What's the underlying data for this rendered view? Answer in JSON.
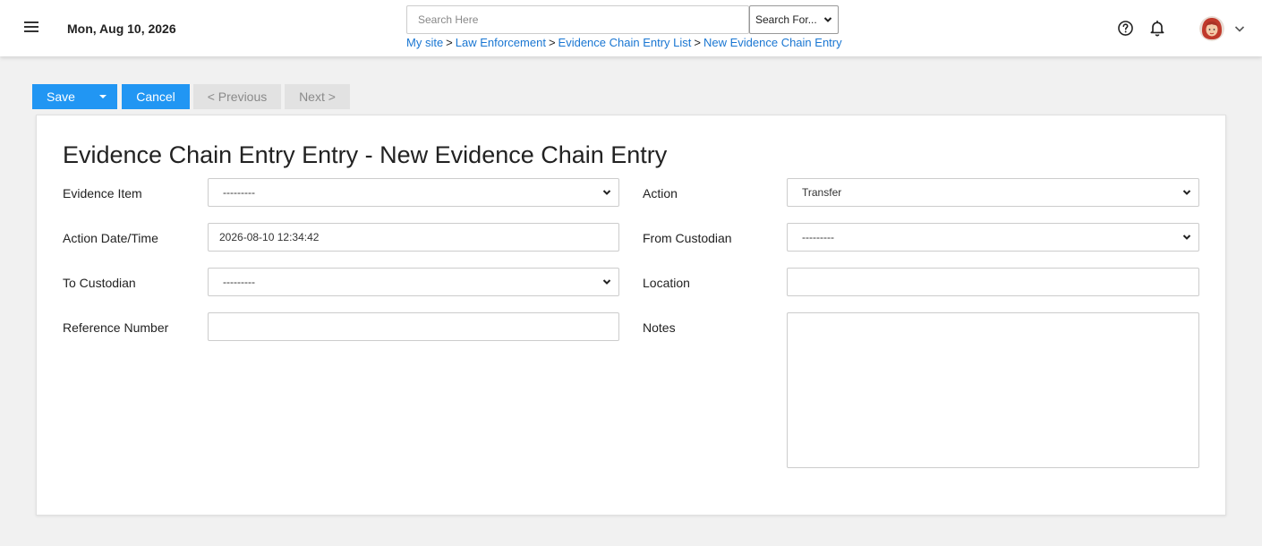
{
  "header": {
    "date": "Mon, Aug 10, 2026",
    "search_placeholder": "Search Here",
    "search_for_label": "Search For...",
    "breadcrumb": [
      {
        "label": "My site"
      },
      {
        "label": "Law Enforcement"
      },
      {
        "label": "Evidence Chain Entry List"
      },
      {
        "label": "New Evidence Chain Entry"
      }
    ],
    "breadcrumb_separator": ">"
  },
  "toolbar": {
    "save_label": "Save",
    "cancel_label": "Cancel",
    "previous_label": "< Previous",
    "next_label": "Next >"
  },
  "form": {
    "title": "Evidence Chain Entry Entry - New Evidence Chain Entry",
    "evidence_item": {
      "label": "Evidence Item",
      "value": "---------"
    },
    "action": {
      "label": "Action",
      "value": "Transfer"
    },
    "action_datetime": {
      "label": "Action Date/Time",
      "value": "2026-08-10 12:34:42"
    },
    "from_custodian": {
      "label": "From Custodian",
      "value": "---------"
    },
    "to_custodian": {
      "label": "To Custodian",
      "value": "---------"
    },
    "location": {
      "label": "Location",
      "value": ""
    },
    "reference_number": {
      "label": "Reference Number",
      "value": ""
    },
    "notes": {
      "label": "Notes",
      "value": ""
    }
  },
  "colors": {
    "accent": "#2196f3",
    "link": "#1976d2",
    "disabled_bg": "#e2e2e2"
  }
}
